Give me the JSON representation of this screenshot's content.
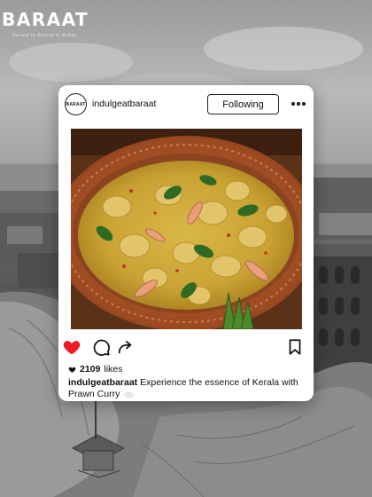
{
  "brand": {
    "logo_text": "BARAAT",
    "tagline": "Baraat in Bharat ki Bahar"
  },
  "post": {
    "username": "indulgeatbaraat",
    "avatar_text": "BARAAT",
    "follow_label": "Following",
    "likes_count": "2109",
    "likes_suffix": "likes",
    "caption_user": "indulgeatbaraat",
    "caption_text": "Experience the essence of Kerala with Prawn Curry",
    "liked": true,
    "icons": {
      "more": "more-dots-icon",
      "like": "heart-icon",
      "comment": "comment-icon",
      "share": "share-icon",
      "save": "bookmark-icon",
      "caption_emoji": "plate-icon"
    }
  },
  "colors": {
    "like_red": "#ed1c24",
    "card_bg": "#ffffff",
    "text": "#111111"
  }
}
